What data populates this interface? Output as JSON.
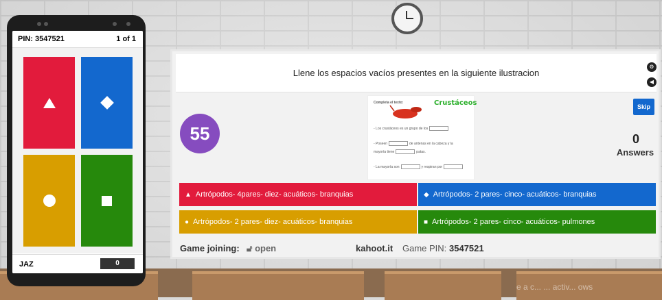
{
  "phone": {
    "pin_label": "PIN: 3547521",
    "question_count": "1 of 1",
    "player_name": "JAZ",
    "player_score": "0",
    "tiles": [
      {
        "shape": "triangle-icon",
        "color": "#e21b3c"
      },
      {
        "shape": "diamond-icon",
        "color": "#1368ce"
      },
      {
        "shape": "circle-icon",
        "color": "#d89e00"
      },
      {
        "shape": "square-icon",
        "color": "#26890c"
      }
    ]
  },
  "board": {
    "question": "Llene los espacios vacíos presentes en la siguiente ilustracion",
    "timer": "55",
    "skip_label": "Skip",
    "answers_count": "0",
    "answers_label": "Answers",
    "image": {
      "heading": "Completa el texto:",
      "logo": "Crustáceos",
      "lines": [
        "- Los crustáceos es un grupo de los",
        "- Poseen",
        "de antenas en la cabeza y la",
        "mayoría tiene",
        "patas.",
        "- La mayoría son",
        "y respiran por"
      ]
    },
    "options": [
      {
        "symbol": "▲",
        "text": "Artrópodos- 4pares- diez- acuáticos- branquias",
        "color": "#e21b3c"
      },
      {
        "symbol": "◆",
        "text": "Artrópodos- 2 pares- cinco- acuáticos- branquias",
        "color": "#1368ce"
      },
      {
        "symbol": "●",
        "text": "Artrópodos- 2 pares- diez- acuáticos- branquias",
        "color": "#d89e00"
      },
      {
        "symbol": "■",
        "text": "Artrópodos- 2 pares- cinco- acuáticos- pulmones",
        "color": "#26890c"
      }
    ],
    "footer": {
      "joining_label": "Game joining:",
      "lock_icon": "lock-icon",
      "joining_status": "open",
      "site": "kahoot.it",
      "pin_label": "Game PIN:",
      "pin_value": "3547521"
    }
  },
  "watermark": "e a c... ... activ... ows"
}
